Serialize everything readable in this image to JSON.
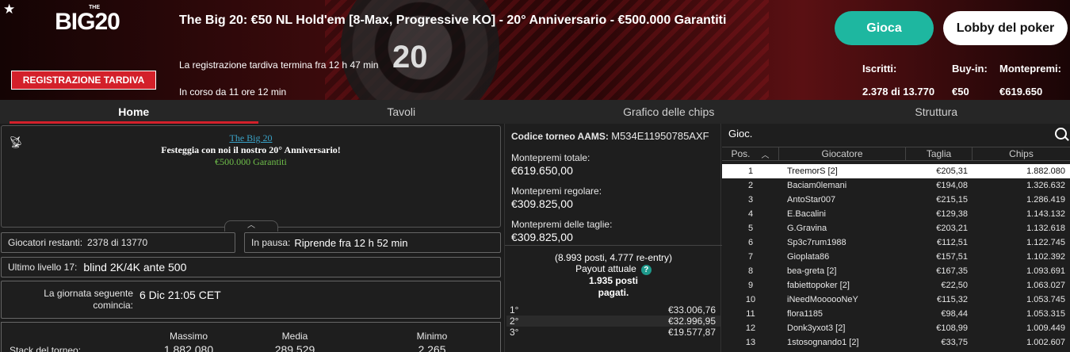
{
  "header": {
    "logo_the": "THE",
    "logo_main": "BIG20",
    "late_reg_badge": "REGISTRAZIONE TARDIVA",
    "title": "The Big 20: €50 NL Hold'em [8-Max, Progressive KO] - 20° Anniversario - €500.000 Garantiti",
    "late_reg_end": "La registrazione tardiva termina fra 12 h 47 min",
    "running_since": "In corso da 11 ore 12 min",
    "play_label": "Gioca",
    "lobby_label": "Lobby del poker",
    "entrants_label": "Iscritti:",
    "buyin_label": "Buy-in:",
    "prize_label": "Montepremi:",
    "entrants_value": "2.378 di 13.770",
    "buyin_value": "€50",
    "prize_value": "€619.650",
    "colors": {
      "accent_red": "#d3202a",
      "play_teal": "#1eb7a0"
    }
  },
  "tabs": [
    {
      "label": "Home",
      "active": true
    },
    {
      "label": "Tavoli"
    },
    {
      "label": "Grafico delle chips"
    },
    {
      "label": "Struttura"
    }
  ],
  "news": {
    "link": "The Big 20",
    "line": "Festeggia con noi il nostro 20° Anniversario!",
    "guarantee": "€500.000 Garantiti"
  },
  "info": {
    "players_left_label": "Giocatori restanti:",
    "players_left_value": "2378 di 13770",
    "pause_label": "In pausa:",
    "pause_value": "Riprende fra 12 h 52 min",
    "level_label": "Ultimo livello 17:",
    "level_value": "blind 2K/4K ante 500",
    "next_day_label_1": "La giornata seguente",
    "next_day_label_2": "comincia:",
    "next_day_value": "6 Dic 21:05 CET",
    "stack_label": "Stack del torneo:",
    "max_label": "Massimo",
    "avg_label": "Media",
    "min_label": "Minimo",
    "max_value": "1.882.080",
    "avg_value": "289.529",
    "min_value": "2.265"
  },
  "prize": {
    "code_label": "Codice torneo AAMS:",
    "code_value": "M534E11950785AXF",
    "total_label": "Montepremi totale:",
    "total_value": "€619.650,00",
    "regular_label": "Montepremi regolare:",
    "regular_value": "€309.825,00",
    "bounty_label": "Montepremi delle taglie:",
    "bounty_value": "€309.825,00",
    "seats": "(8.993 posti, 4.777 re-entry)",
    "payout_label": "Payout attuale",
    "paid_1": "1.935 posti",
    "paid_2": "pagati.",
    "payouts": [
      {
        "place": "1°",
        "amount": "€33.006,76"
      },
      {
        "place": "2°",
        "amount": "€32.996,95"
      },
      {
        "place": "3°",
        "amount": "€19.577,87"
      }
    ]
  },
  "players": {
    "search_label": "Gioc.",
    "columns": [
      "Pos.",
      "Giocatore",
      "Taglia",
      "Chips"
    ],
    "rows": [
      {
        "pos": "1",
        "name": "TreemorS [2]",
        "bounty": "€205,31",
        "chips": "1.882.080"
      },
      {
        "pos": "2",
        "name": "Baciam0lemani",
        "bounty": "€194,08",
        "chips": "1.326.632"
      },
      {
        "pos": "3",
        "name": "AntoStar007",
        "bounty": "€215,15",
        "chips": "1.286.419"
      },
      {
        "pos": "4",
        "name": "E.Bacalini",
        "bounty": "€129,38",
        "chips": "1.143.132"
      },
      {
        "pos": "5",
        "name": "G.Gravina",
        "bounty": "€203,21",
        "chips": "1.132.618"
      },
      {
        "pos": "6",
        "name": "Sp3c7rum1988",
        "bounty": "€112,51",
        "chips": "1.122.745"
      },
      {
        "pos": "7",
        "name": "Gioplata86",
        "bounty": "€157,51",
        "chips": "1.102.392"
      },
      {
        "pos": "8",
        "name": "bea-greta [2]",
        "bounty": "€167,35",
        "chips": "1.093.691"
      },
      {
        "pos": "9",
        "name": "fabiettopoker [2]",
        "bounty": "€22,50",
        "chips": "1.063.027"
      },
      {
        "pos": "10",
        "name": "iNeedMoooooNeY",
        "bounty": "€115,32",
        "chips": "1.053.745"
      },
      {
        "pos": "11",
        "name": "flora1185",
        "bounty": "€98,44",
        "chips": "1.053.315"
      },
      {
        "pos": "12",
        "name": "Donk3yxot3 [2]",
        "bounty": "€108,99",
        "chips": "1.009.449"
      },
      {
        "pos": "13",
        "name": "1stosognando1 [2]",
        "bounty": "€33,75",
        "chips": "1.002.607"
      }
    ]
  }
}
